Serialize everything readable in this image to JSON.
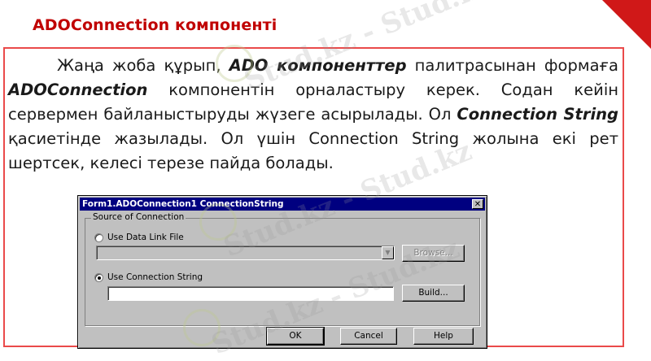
{
  "slide": {
    "title": "ADOConnection компоненті",
    "paragraph": {
      "p1": "Жаңа жоба құрып, ",
      "b1": "ADO компоненттер",
      "p2": " палитрасынан формаға ",
      "b2": "ADOConnection",
      "p3": " компонентін орналастыру керек. Содан кейін сервермен байланыстыруды жүзеге асырылады. Ол ",
      "b3": "Connection String",
      "p4": " қасиетінде жазылады. Ол үшін Connection String жолына екі рет шертсек, келесі терезе пайда болады."
    },
    "watermark": "Stud.kz - Stud.kz"
  },
  "dialog": {
    "title": "Form1.ADOConnection1 ConnectionString",
    "close_glyph": "✕",
    "group_label": "Source of Connection",
    "radio_data_link": "Use Data Link File",
    "radio_conn_string": "Use Connection String",
    "data_link_value": "",
    "conn_string_value": "",
    "browse_label": "Browse...",
    "build_label": "Build...",
    "ok_label": "OK",
    "cancel_label": "Cancel",
    "help_label": "Help",
    "selected_radio": "conn_string"
  },
  "colors": {
    "title_red": "#c00000",
    "border_red": "#ea4a4a",
    "win_titlebar": "#000080",
    "win_face": "#c0c0c0"
  },
  "icons": [
    "close-icon",
    "dropdown-arrow-icon"
  ]
}
